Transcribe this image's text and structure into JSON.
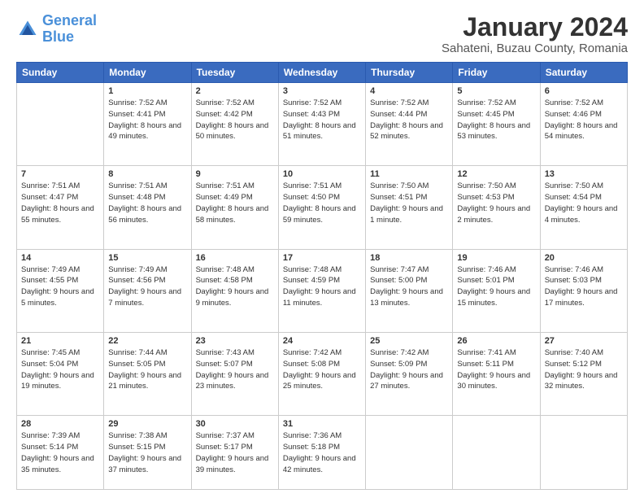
{
  "logo": {
    "line1": "General",
    "line2": "Blue"
  },
  "title": "January 2024",
  "subtitle": "Sahateni, Buzau County, Romania",
  "weekdays": [
    "Sunday",
    "Monday",
    "Tuesday",
    "Wednesday",
    "Thursday",
    "Friday",
    "Saturday"
  ],
  "weeks": [
    [
      {
        "day": "",
        "sunrise": "",
        "sunset": "",
        "daylight": ""
      },
      {
        "day": "1",
        "sunrise": "Sunrise: 7:52 AM",
        "sunset": "Sunset: 4:41 PM",
        "daylight": "Daylight: 8 hours and 49 minutes."
      },
      {
        "day": "2",
        "sunrise": "Sunrise: 7:52 AM",
        "sunset": "Sunset: 4:42 PM",
        "daylight": "Daylight: 8 hours and 50 minutes."
      },
      {
        "day": "3",
        "sunrise": "Sunrise: 7:52 AM",
        "sunset": "Sunset: 4:43 PM",
        "daylight": "Daylight: 8 hours and 51 minutes."
      },
      {
        "day": "4",
        "sunrise": "Sunrise: 7:52 AM",
        "sunset": "Sunset: 4:44 PM",
        "daylight": "Daylight: 8 hours and 52 minutes."
      },
      {
        "day": "5",
        "sunrise": "Sunrise: 7:52 AM",
        "sunset": "Sunset: 4:45 PM",
        "daylight": "Daylight: 8 hours and 53 minutes."
      },
      {
        "day": "6",
        "sunrise": "Sunrise: 7:52 AM",
        "sunset": "Sunset: 4:46 PM",
        "daylight": "Daylight: 8 hours and 54 minutes."
      }
    ],
    [
      {
        "day": "7",
        "sunrise": "Sunrise: 7:51 AM",
        "sunset": "Sunset: 4:47 PM",
        "daylight": "Daylight: 8 hours and 55 minutes."
      },
      {
        "day": "8",
        "sunrise": "Sunrise: 7:51 AM",
        "sunset": "Sunset: 4:48 PM",
        "daylight": "Daylight: 8 hours and 56 minutes."
      },
      {
        "day": "9",
        "sunrise": "Sunrise: 7:51 AM",
        "sunset": "Sunset: 4:49 PM",
        "daylight": "Daylight: 8 hours and 58 minutes."
      },
      {
        "day": "10",
        "sunrise": "Sunrise: 7:51 AM",
        "sunset": "Sunset: 4:50 PM",
        "daylight": "Daylight: 8 hours and 59 minutes."
      },
      {
        "day": "11",
        "sunrise": "Sunrise: 7:50 AM",
        "sunset": "Sunset: 4:51 PM",
        "daylight": "Daylight: 9 hours and 1 minute."
      },
      {
        "day": "12",
        "sunrise": "Sunrise: 7:50 AM",
        "sunset": "Sunset: 4:53 PM",
        "daylight": "Daylight: 9 hours and 2 minutes."
      },
      {
        "day": "13",
        "sunrise": "Sunrise: 7:50 AM",
        "sunset": "Sunset: 4:54 PM",
        "daylight": "Daylight: 9 hours and 4 minutes."
      }
    ],
    [
      {
        "day": "14",
        "sunrise": "Sunrise: 7:49 AM",
        "sunset": "Sunset: 4:55 PM",
        "daylight": "Daylight: 9 hours and 5 minutes."
      },
      {
        "day": "15",
        "sunrise": "Sunrise: 7:49 AM",
        "sunset": "Sunset: 4:56 PM",
        "daylight": "Daylight: 9 hours and 7 minutes."
      },
      {
        "day": "16",
        "sunrise": "Sunrise: 7:48 AM",
        "sunset": "Sunset: 4:58 PM",
        "daylight": "Daylight: 9 hours and 9 minutes."
      },
      {
        "day": "17",
        "sunrise": "Sunrise: 7:48 AM",
        "sunset": "Sunset: 4:59 PM",
        "daylight": "Daylight: 9 hours and 11 minutes."
      },
      {
        "day": "18",
        "sunrise": "Sunrise: 7:47 AM",
        "sunset": "Sunset: 5:00 PM",
        "daylight": "Daylight: 9 hours and 13 minutes."
      },
      {
        "day": "19",
        "sunrise": "Sunrise: 7:46 AM",
        "sunset": "Sunset: 5:01 PM",
        "daylight": "Daylight: 9 hours and 15 minutes."
      },
      {
        "day": "20",
        "sunrise": "Sunrise: 7:46 AM",
        "sunset": "Sunset: 5:03 PM",
        "daylight": "Daylight: 9 hours and 17 minutes."
      }
    ],
    [
      {
        "day": "21",
        "sunrise": "Sunrise: 7:45 AM",
        "sunset": "Sunset: 5:04 PM",
        "daylight": "Daylight: 9 hours and 19 minutes."
      },
      {
        "day": "22",
        "sunrise": "Sunrise: 7:44 AM",
        "sunset": "Sunset: 5:05 PM",
        "daylight": "Daylight: 9 hours and 21 minutes."
      },
      {
        "day": "23",
        "sunrise": "Sunrise: 7:43 AM",
        "sunset": "Sunset: 5:07 PM",
        "daylight": "Daylight: 9 hours and 23 minutes."
      },
      {
        "day": "24",
        "sunrise": "Sunrise: 7:42 AM",
        "sunset": "Sunset: 5:08 PM",
        "daylight": "Daylight: 9 hours and 25 minutes."
      },
      {
        "day": "25",
        "sunrise": "Sunrise: 7:42 AM",
        "sunset": "Sunset: 5:09 PM",
        "daylight": "Daylight: 9 hours and 27 minutes."
      },
      {
        "day": "26",
        "sunrise": "Sunrise: 7:41 AM",
        "sunset": "Sunset: 5:11 PM",
        "daylight": "Daylight: 9 hours and 30 minutes."
      },
      {
        "day": "27",
        "sunrise": "Sunrise: 7:40 AM",
        "sunset": "Sunset: 5:12 PM",
        "daylight": "Daylight: 9 hours and 32 minutes."
      }
    ],
    [
      {
        "day": "28",
        "sunrise": "Sunrise: 7:39 AM",
        "sunset": "Sunset: 5:14 PM",
        "daylight": "Daylight: 9 hours and 35 minutes."
      },
      {
        "day": "29",
        "sunrise": "Sunrise: 7:38 AM",
        "sunset": "Sunset: 5:15 PM",
        "daylight": "Daylight: 9 hours and 37 minutes."
      },
      {
        "day": "30",
        "sunrise": "Sunrise: 7:37 AM",
        "sunset": "Sunset: 5:17 PM",
        "daylight": "Daylight: 9 hours and 39 minutes."
      },
      {
        "day": "31",
        "sunrise": "Sunrise: 7:36 AM",
        "sunset": "Sunset: 5:18 PM",
        "daylight": "Daylight: 9 hours and 42 minutes."
      },
      {
        "day": "",
        "sunrise": "",
        "sunset": "",
        "daylight": ""
      },
      {
        "day": "",
        "sunrise": "",
        "sunset": "",
        "daylight": ""
      },
      {
        "day": "",
        "sunrise": "",
        "sunset": "",
        "daylight": ""
      }
    ]
  ]
}
